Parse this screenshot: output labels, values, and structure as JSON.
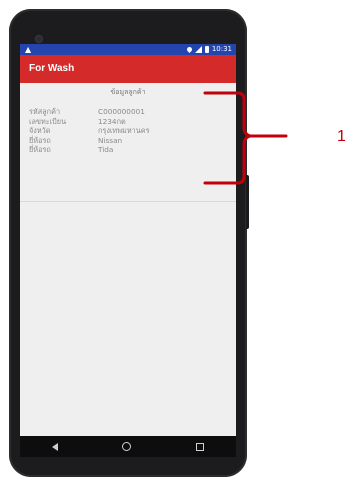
{
  "status_bar": {
    "warning_glyph": "▲",
    "time": "10:31"
  },
  "app_bar": {
    "title": "For Wash"
  },
  "customer_info": {
    "section_title": "ข้อมูลลูกค้า",
    "rows": [
      {
        "label": "รหัสลูกค้า",
        "value": "C000000001"
      },
      {
        "label": "เลขทะเบียน",
        "value": "1234กต"
      },
      {
        "label": "จังหวัด",
        "value": "กรุงเทพมหานคร"
      },
      {
        "label": "ยี่ห้อรถ",
        "value": "Nissan"
      },
      {
        "label": "ยี่ห้อรถ",
        "value": "Tida"
      }
    ]
  },
  "annotation": {
    "number": "1",
    "color": "#c0000b"
  },
  "colors": {
    "app_bar": "#d42a2a",
    "status_bar": "#2345ad",
    "nav_bar": "#0d0d0d",
    "screen_bg": "#efefef"
  },
  "icons": [
    "warning-icon",
    "location-icon",
    "signal-icon",
    "battery-icon",
    "nav-back-icon",
    "nav-home-icon",
    "nav-recent-icon"
  ]
}
